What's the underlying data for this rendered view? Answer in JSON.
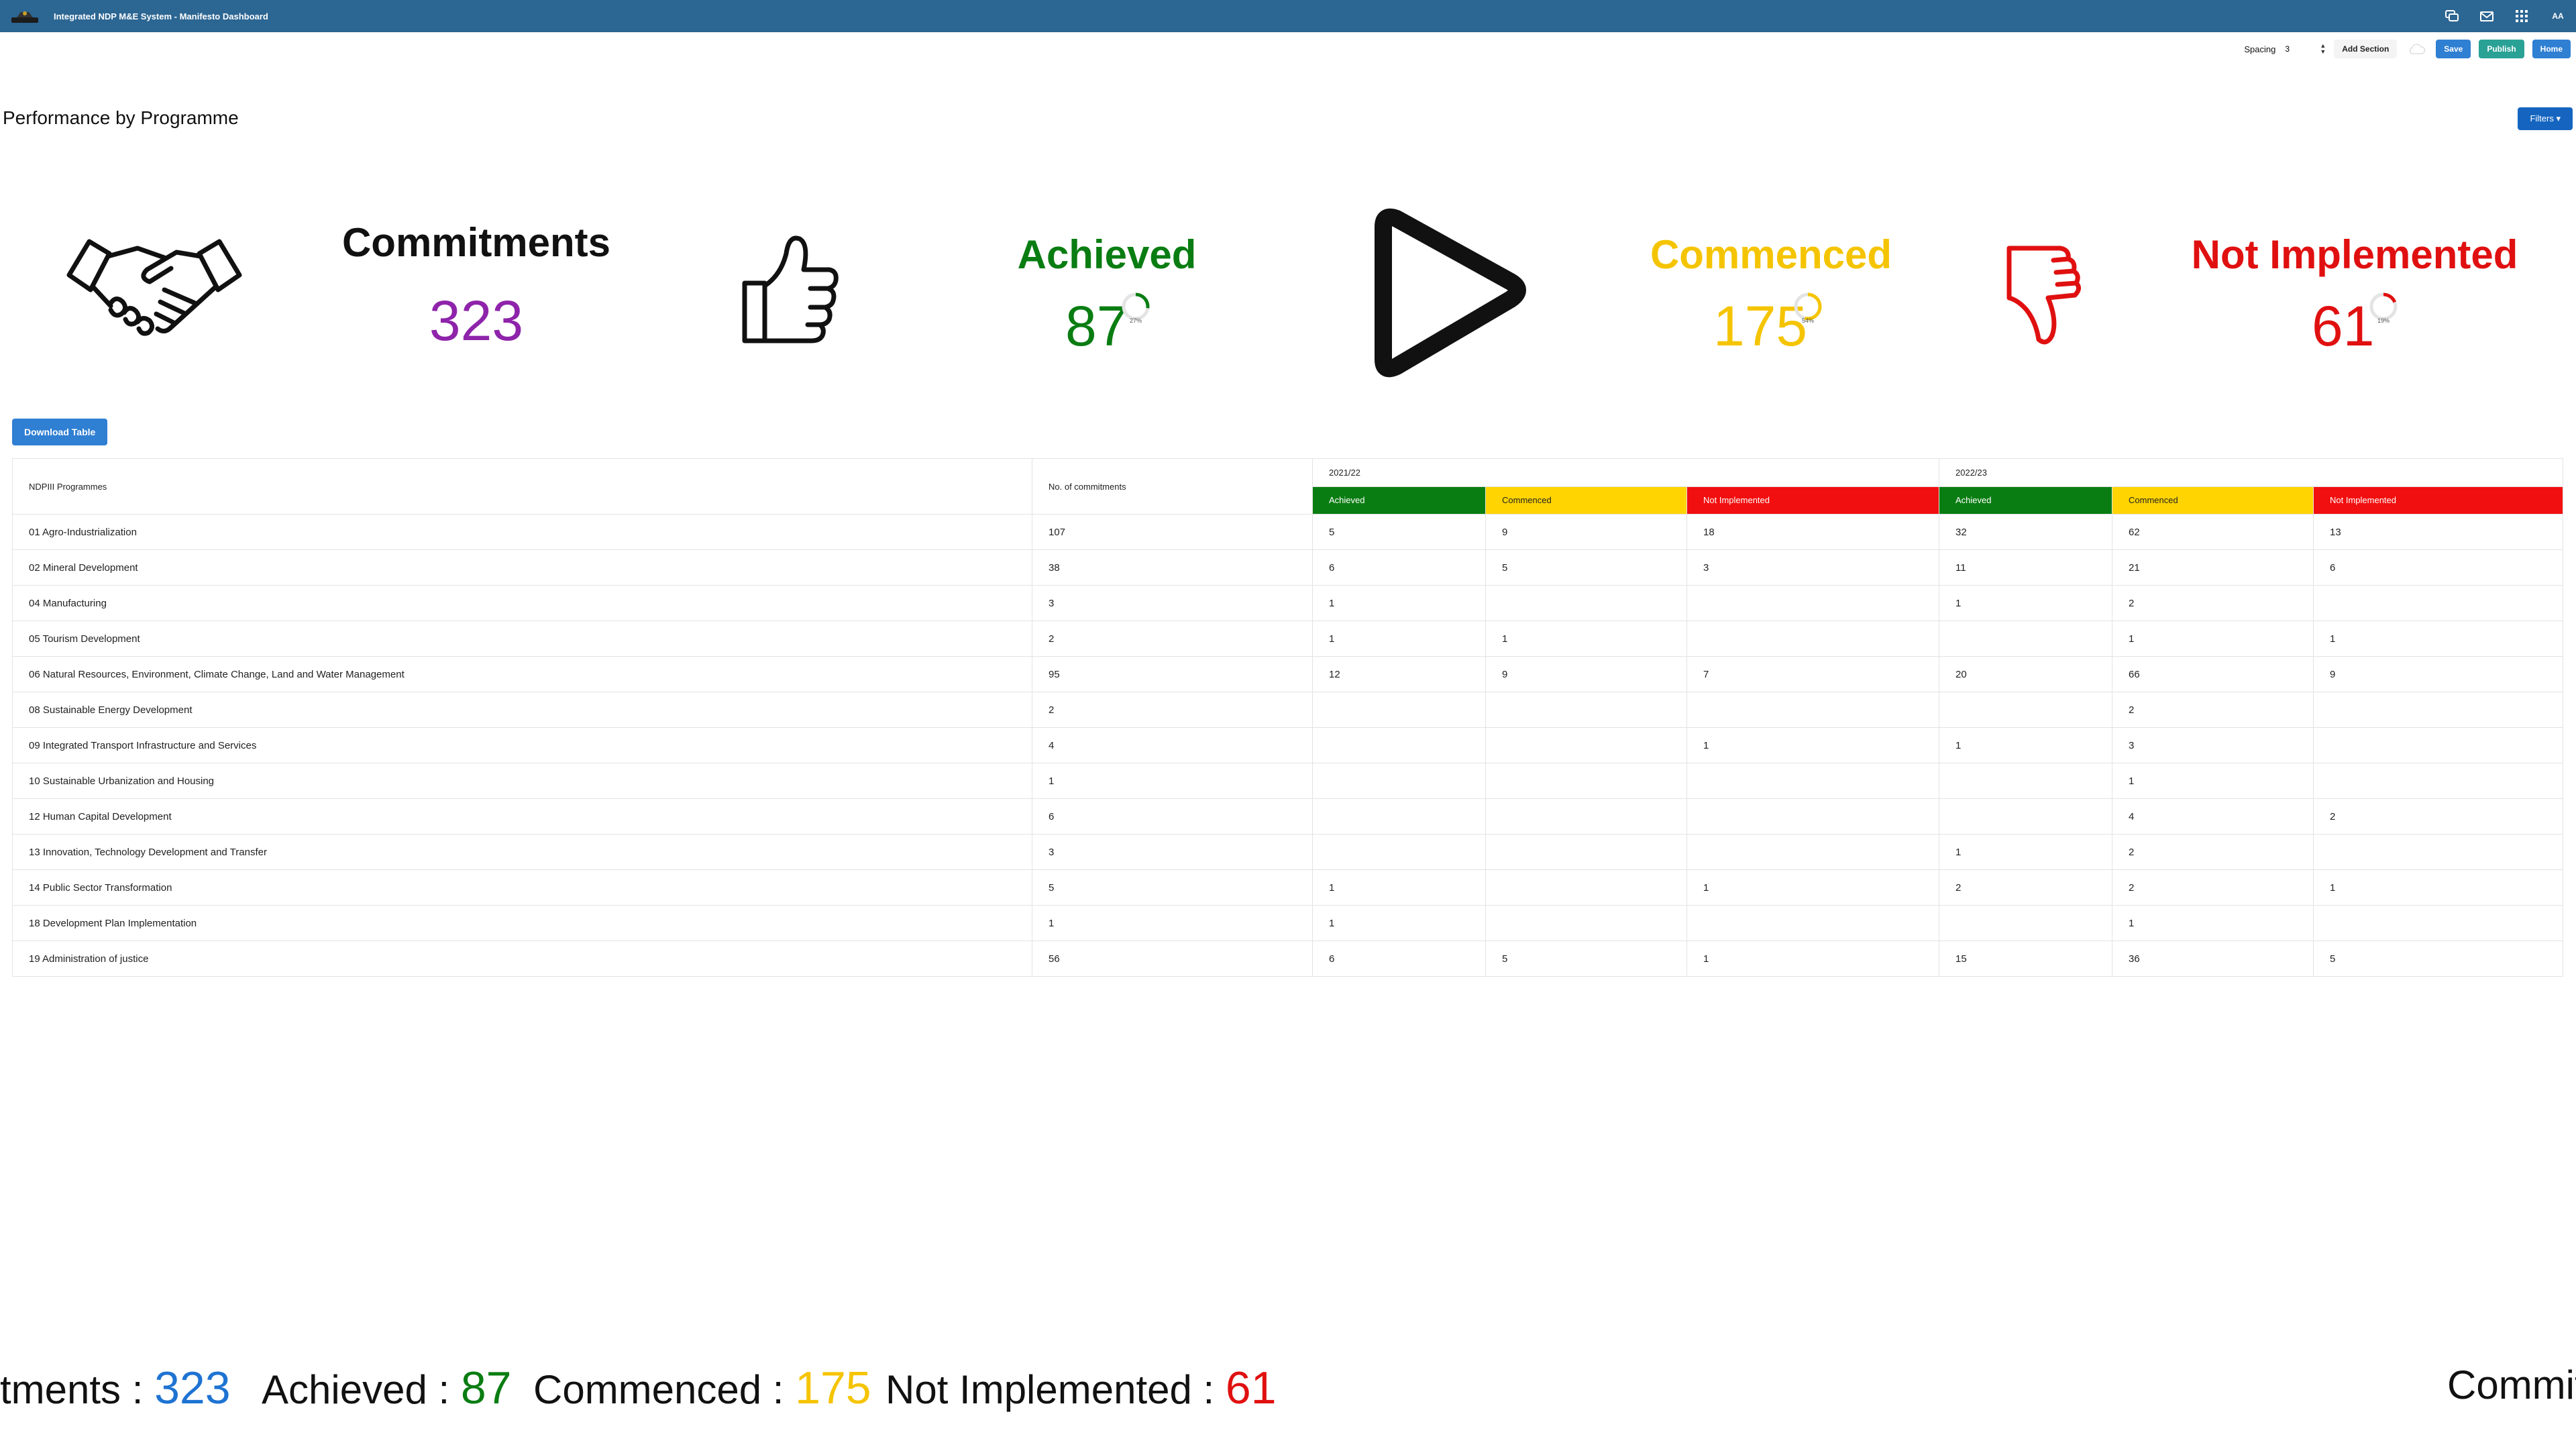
{
  "header": {
    "app_title": "Integrated NDP M&E System - Manifesto Dashboard",
    "user_initials": "AA"
  },
  "toolbar": {
    "spacing_label": "Spacing",
    "spacing_value": "3",
    "add_section": "Add Section",
    "save": "Save",
    "publish": "Publish",
    "home": "Home"
  },
  "page": {
    "title": "Performance by Programme",
    "filters": "Filters"
  },
  "kpis": {
    "commitments": {
      "label": "Commitments",
      "value": "323",
      "icon": "handshake-icon",
      "color": "#8e24aa"
    },
    "achieved": {
      "label": "Achieved",
      "value": "87",
      "percent": "27%",
      "fraction": 0.27,
      "icon": "thumbs-up-icon",
      "color": "#0a7d12"
    },
    "commenced": {
      "label": "Commenced",
      "value": "175",
      "percent": "54%",
      "fraction": 0.54,
      "icon": "play-icon",
      "color": "#f5c400"
    },
    "not_implemented": {
      "label": "Not Implemented",
      "value": "61",
      "percent": "19%",
      "fraction": 0.19,
      "icon": "thumbs-down-icon",
      "color": "#e01010"
    }
  },
  "table": {
    "download_label": "Download Table",
    "col_programmes": "NDPIII Programmes",
    "col_commitments": "No. of commitments",
    "years": [
      "2021/22",
      "2022/23"
    ],
    "status_headers": [
      "Achieved",
      "Commenced",
      "Not Implemented"
    ],
    "rows": [
      [
        "01 Agro-Industrialization",
        "107",
        "5",
        "9",
        "18",
        "32",
        "62",
        "13"
      ],
      [
        "02 Mineral Development",
        "38",
        "6",
        "5",
        "3",
        "11",
        "21",
        "6"
      ],
      [
        "04 Manufacturing",
        "3",
        "1",
        "",
        "",
        "1",
        "2",
        ""
      ],
      [
        "05 Tourism Development",
        "2",
        "1",
        "1",
        "",
        "",
        "1",
        "1"
      ],
      [
        "06 Natural Resources, Environment, Climate Change, Land and Water Management",
        "95",
        "12",
        "9",
        "7",
        "20",
        "66",
        "9"
      ],
      [
        "08 Sustainable Energy Development",
        "2",
        "",
        "",
        "",
        "",
        "2",
        ""
      ],
      [
        "09 Integrated Transport Infrastructure and Services",
        "4",
        "",
        "",
        "1",
        "1",
        "3",
        ""
      ],
      [
        "10 Sustainable Urbanization and Housing",
        "1",
        "",
        "",
        "",
        "",
        "1",
        ""
      ],
      [
        "12 Human Capital Development",
        "6",
        "",
        "",
        "",
        "",
        "4",
        "2"
      ],
      [
        "13 Innovation, Technology Development and Transfer",
        "3",
        "",
        "",
        "",
        "1",
        "2",
        ""
      ],
      [
        "14 Public Sector Transformation",
        "5",
        "1",
        "",
        "1",
        "2",
        "2",
        "1"
      ],
      [
        "18 Development Plan Implementation",
        "1",
        "1",
        "",
        "",
        "",
        "1",
        ""
      ],
      [
        "19 Administration of justice",
        "56",
        "6",
        "5",
        "1",
        "15",
        "36",
        "5"
      ]
    ]
  },
  "ticker": {
    "items": [
      {
        "label": "tments : ",
        "value": "323",
        "color": "#1e73d2"
      },
      {
        "label": "Achieved : ",
        "value": "87",
        "color": "#0a7d12"
      },
      {
        "label": "Commenced : ",
        "value": "175",
        "color": "#f5c400"
      },
      {
        "label": "Not Implemented : ",
        "value": "61",
        "color": "#e01010"
      },
      {
        "label": "Commit",
        "value": "",
        "color": "#1e73d2"
      }
    ]
  },
  "colors": {
    "topbar": "#2c6693",
    "achieved_header": "#0a7d12",
    "commenced_header": "#ffd400",
    "not_implemented_header": "#f20f0f"
  }
}
